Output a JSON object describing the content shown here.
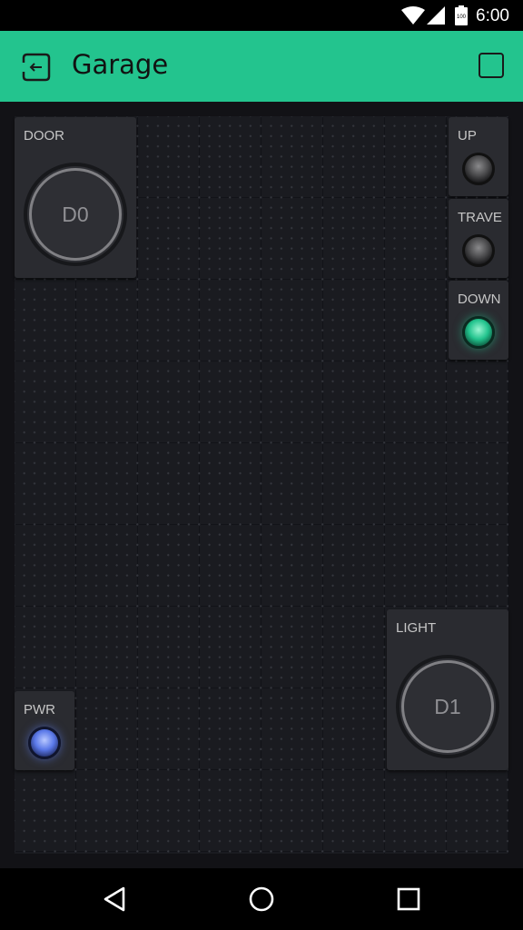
{
  "status_bar": {
    "time": "6:00",
    "battery_text": "100",
    "icons": [
      "wifi-icon",
      "signal-icon",
      "battery-icon"
    ]
  },
  "app_bar": {
    "title": "Garage",
    "back_icon": "exit-project-icon",
    "play_icon": "stop-square-icon",
    "color": "#23c48e"
  },
  "widgets": {
    "door": {
      "label": "DOOR",
      "pin": "D0"
    },
    "up": {
      "label": "UP",
      "state": "off"
    },
    "trave": {
      "label": "TRAVE",
      "state": "off"
    },
    "down": {
      "label": "DOWN",
      "state": "on",
      "color": "#23c48e"
    },
    "light": {
      "label": "LIGHT",
      "pin": "D1"
    },
    "pwr": {
      "label": "PWR",
      "state": "on",
      "color": "#5a78e8"
    }
  },
  "nav_bar": {
    "icons": [
      "back-triangle-icon",
      "home-circle-icon",
      "recents-square-icon"
    ]
  }
}
